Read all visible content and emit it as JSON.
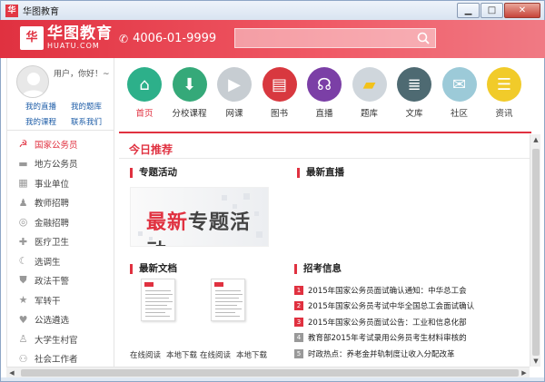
{
  "window": {
    "title": "华图教育",
    "min_label": "▁",
    "max_label": "□",
    "close_label": "✕"
  },
  "header": {
    "logo_mark": "华",
    "logo_cn": "华图教育",
    "logo_en": "HUATU.COM",
    "phone": "4006-01-9999",
    "search_placeholder": ""
  },
  "user": {
    "greeting": "用户，你好！~",
    "links": [
      "我的直播",
      "我的题库",
      "我的课程",
      "联系我们"
    ]
  },
  "sidebar": {
    "items": [
      {
        "label": "国家公务员",
        "icon": "party-emblem-icon",
        "active": true
      },
      {
        "label": "地方公务员",
        "icon": "hat-icon"
      },
      {
        "label": "事业单位",
        "icon": "building-icon"
      },
      {
        "label": "教师招聘",
        "icon": "teacher-icon"
      },
      {
        "label": "金融招聘",
        "icon": "coin-icon"
      },
      {
        "label": "医疗卫生",
        "icon": "medical-cross-icon"
      },
      {
        "label": "选调生",
        "icon": "moon-icon"
      },
      {
        "label": "政法干警",
        "icon": "shield-icon"
      },
      {
        "label": "军转干",
        "icon": "star-icon"
      },
      {
        "label": "公选遴选",
        "icon": "heart-icon"
      },
      {
        "label": "大学生村官",
        "icon": "person-icon"
      },
      {
        "label": "社会工作者",
        "icon": "group-icon"
      }
    ]
  },
  "categories": [
    {
      "label": "首页",
      "icon": "home-icon",
      "color": "#2db08a",
      "active": true
    },
    {
      "label": "分校课程",
      "icon": "download-icon",
      "color": "#35a979"
    },
    {
      "label": "网课",
      "icon": "play-icon",
      "color": "#c7cdd2"
    },
    {
      "label": "图书",
      "icon": "book-icon",
      "color": "#d8383f"
    },
    {
      "label": "直播",
      "icon": "headphones-icon",
      "color": "#7b3fa6"
    },
    {
      "label": "题库",
      "icon": "folder-icon",
      "color": "#cfd6dc"
    },
    {
      "label": "文库",
      "icon": "database-icon",
      "color": "#4e6a72"
    },
    {
      "label": "社区",
      "icon": "chat-icon",
      "color": "#9ccad8"
    },
    {
      "label": "资讯",
      "icon": "news-icon",
      "color": "#f1cb2a"
    }
  ],
  "main": {
    "today": "今日推荐",
    "special_title": "专题活动",
    "banner_highlight": "最新",
    "banner_rest": "专题活动",
    "live_title": "最新直播",
    "docs_title": "最新文档",
    "docs": [
      {
        "read": "在线阅读",
        "download": "本地下载"
      },
      {
        "read": "在线阅读",
        "download": "本地下载"
      }
    ],
    "exam_title": "招考信息",
    "news": [
      {
        "num": "1",
        "text": "2015年国家公务员面试确认通知：中华总工会"
      },
      {
        "num": "2",
        "text": "2015年国家公务员考试中华全国总工会面试确认"
      },
      {
        "num": "3",
        "text": "2015年国家公务员面试公告：工业和信息化部"
      },
      {
        "num": "4",
        "text": "教育部2015年考试录用公务员考生材料审核的"
      },
      {
        "num": "5",
        "text": "时政热点：养老金并轨制度让收入分配改革"
      }
    ]
  },
  "scroll": {
    "up": "▲",
    "down": "▼",
    "left": "◀",
    "right": "▶"
  }
}
